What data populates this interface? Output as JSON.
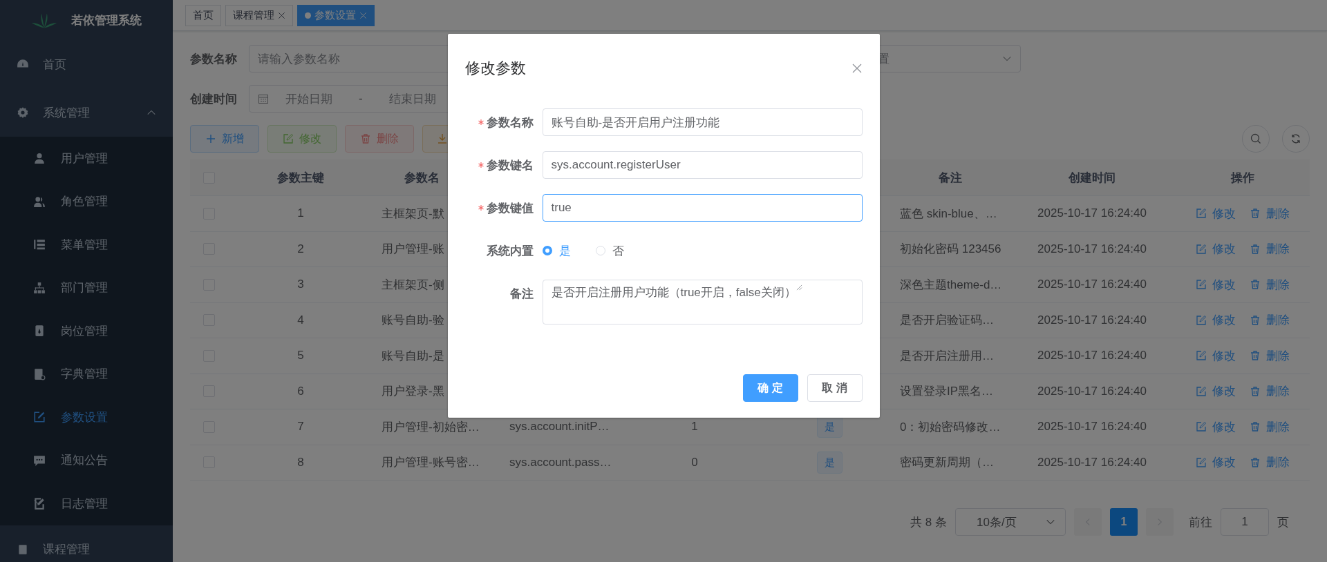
{
  "sidebar": {
    "title": "若依管理系统",
    "items": [
      {
        "label": "首页",
        "selected": false
      },
      {
        "label": "系统管理",
        "expanded": true,
        "children": [
          {
            "label": "用户管理",
            "selected": false
          },
          {
            "label": "角色管理",
            "selected": false
          },
          {
            "label": "菜单管理",
            "selected": false
          },
          {
            "label": "部门管理",
            "selected": false
          },
          {
            "label": "岗位管理",
            "selected": false
          },
          {
            "label": "字典管理",
            "selected": false
          },
          {
            "label": "参数设置",
            "selected": true
          },
          {
            "label": "通知公告",
            "selected": false
          },
          {
            "label": "日志管理",
            "expanded": false
          }
        ]
      },
      {
        "label": "课程管理",
        "selected": false
      }
    ]
  },
  "tabs": [
    {
      "label": "首页",
      "selected": false,
      "closable": false
    },
    {
      "label": "课程管理",
      "selected": false,
      "closable": true
    },
    {
      "label": "参数设置",
      "selected": true,
      "closable": true
    }
  ],
  "search": {
    "name_label": "参数名称",
    "name_placeholder": "请输入参数名称",
    "type_placeholder": "置",
    "time_label": "创建时间",
    "start_placeholder": "开始日期",
    "separator": "-",
    "end_placeholder": "结束日期"
  },
  "toolbar": [
    {
      "kind": "add",
      "label": "新增",
      "disabled": false
    },
    {
      "kind": "edit",
      "label": "修改",
      "disabled": true
    },
    {
      "kind": "delete",
      "label": "删除",
      "disabled": true
    },
    {
      "kind": "export"
    }
  ],
  "table": {
    "select_all_checked": false,
    "columns": [
      {
        "label": "参数主键"
      },
      {
        "label": "参数名"
      },
      {},
      {},
      {},
      {
        "label": "备注"
      },
      {
        "label": "创建时间"
      },
      {
        "label": "操作"
      }
    ],
    "rows": [
      {
        "checked": false,
        "id": "1",
        "name": "主框架页-默",
        "remark": "蓝色 skin-blue、…",
        "created": "2025-10-17 16:24:40",
        "actions": [
          {
            "kind": "edit",
            "label": "修改"
          },
          {
            "kind": "delete",
            "label": "删除"
          }
        ]
      },
      {
        "checked": false,
        "id": "2",
        "name": "用户管理-账",
        "remark": "初始化密码 123456",
        "created": "2025-10-17 16:24:40",
        "actions": [
          {
            "kind": "edit",
            "label": "修改"
          },
          {
            "kind": "delete",
            "label": "删除"
          }
        ]
      },
      {
        "checked": false,
        "id": "3",
        "name": "主框架页-侧",
        "remark": "深色主题theme-d…",
        "created": "2025-10-17 16:24:40",
        "actions": [
          {
            "kind": "edit",
            "label": "修改"
          },
          {
            "kind": "delete",
            "label": "删除"
          }
        ]
      },
      {
        "checked": false,
        "id": "4",
        "name": "账号自助-验",
        "remark": "是否开启验证码…",
        "created": "2025-10-17 16:24:40",
        "actions": [
          {
            "kind": "edit",
            "label": "修改"
          },
          {
            "kind": "delete",
            "label": "删除"
          }
        ]
      },
      {
        "checked": false,
        "id": "5",
        "name": "账号自助-是",
        "remark": "是否开启注册用…",
        "created": "2025-10-17 16:24:40",
        "actions": [
          {
            "kind": "edit",
            "label": "修改"
          },
          {
            "kind": "delete",
            "label": "删除"
          }
        ]
      },
      {
        "checked": false,
        "id": "6",
        "name": "用户登录-黑",
        "remark": "设置登录IP黑名…",
        "created": "2025-10-17 16:24:40",
        "actions": [
          {
            "kind": "edit",
            "label": "修改"
          },
          {
            "kind": "delete",
            "label": "删除"
          }
        ]
      },
      {
        "checked": false,
        "id": "7",
        "name": "用户管理-初始密…",
        "key": "sys.account.initP…",
        "value": "1",
        "builtin": "是",
        "remark": "0：初始密码修改…",
        "created": "2025-10-17 16:24:40",
        "actions": [
          {
            "kind": "edit",
            "label": "修改"
          },
          {
            "kind": "delete",
            "label": "删除"
          }
        ]
      },
      {
        "checked": false,
        "id": "8",
        "name": "用户管理-账号密…",
        "key": "sys.account.pass…",
        "value": "0",
        "builtin": "是",
        "remark": "密码更新周期（…",
        "created": "2025-10-17 16:24:40",
        "actions": [
          {
            "kind": "edit",
            "label": "修改"
          },
          {
            "kind": "delete",
            "label": "删除"
          }
        ]
      }
    ]
  },
  "pagination": {
    "total": "共 8 条",
    "page_size": "10条/页",
    "pages": [
      {
        "label": "1",
        "selected": true
      }
    ],
    "goto_label": "前往",
    "goto_value": "1",
    "goto_suffix": "页"
  },
  "dialog": {
    "title": "修改参数",
    "fields": [
      {
        "kind": "input",
        "label": "参数名称",
        "required": true,
        "value": "账号自助-是否开启用户注册功能",
        "focused": false
      },
      {
        "kind": "input",
        "label": "参数键名",
        "required": true,
        "value": "sys.account.registerUser",
        "focused": false
      },
      {
        "kind": "input",
        "label": "参数键值",
        "required": true,
        "value": "true",
        "focused": true
      },
      {
        "kind": "radio",
        "label": "系统内置",
        "required": false,
        "options": [
          {
            "label": "是",
            "selected": true
          },
          {
            "label": "否",
            "selected": false
          }
        ]
      },
      {
        "kind": "textarea",
        "label": "备注",
        "required": false,
        "value": "是否开启注册用户功能（true开启，false关闭）"
      }
    ],
    "buttons": [
      {
        "kind": "primary",
        "label": "确 定"
      },
      {
        "kind": "default",
        "label": "取 消"
      }
    ]
  }
}
